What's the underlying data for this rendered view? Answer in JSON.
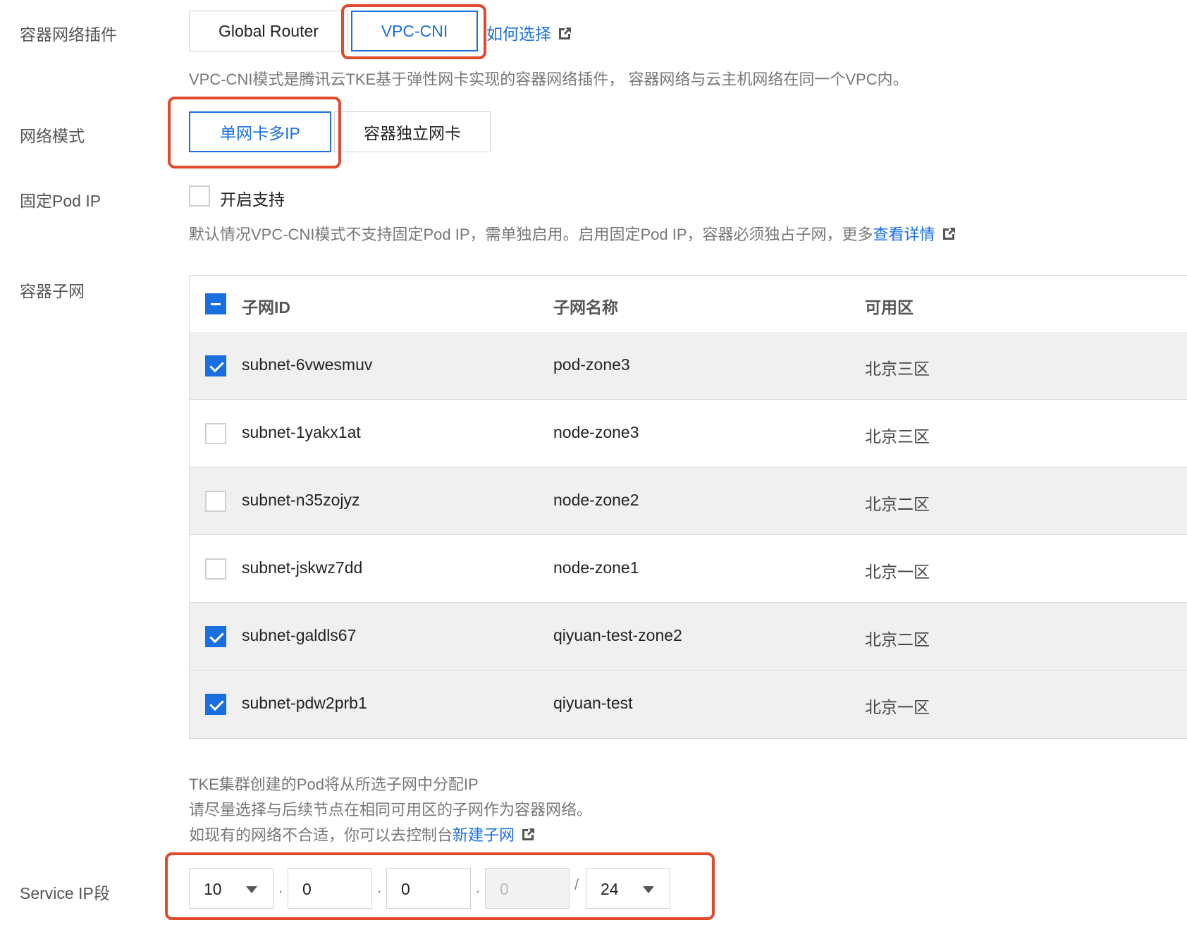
{
  "plugin": {
    "label": "容器网络插件",
    "options": [
      "Global Router",
      "VPC-CNI"
    ],
    "selected": "VPC-CNI",
    "help_link": "如何选择",
    "description": "VPC-CNI模式是腾讯云TKE基于弹性网卡实现的容器网络插件， 容器网络与云主机网络在同一个VPC内。"
  },
  "network_mode": {
    "label": "网络模式",
    "options": [
      "单网卡多IP",
      "容器独立网卡"
    ],
    "selected": "单网卡多IP"
  },
  "fixed_pod_ip": {
    "label": "固定Pod IP",
    "checkbox_label": "开启支持",
    "checked": false,
    "description": "默认情况VPC-CNI模式不支持固定Pod IP，需单独启用。启用固定Pod IP，容器必须独占子网，更多",
    "details_link": "查看详情"
  },
  "subnets": {
    "label": "容器子网",
    "columns": [
      "子网ID",
      "子网名称",
      "可用区"
    ],
    "rows": [
      {
        "id": "subnet-6vwesmuv",
        "name": "pod-zone3",
        "zone": "北京三区",
        "checked": true
      },
      {
        "id": "subnet-1yakx1at",
        "name": "node-zone3",
        "zone": "北京三区",
        "checked": false
      },
      {
        "id": "subnet-n35zojyz",
        "name": "node-zone2",
        "zone": "北京二区",
        "checked": false
      },
      {
        "id": "subnet-jskwz7dd",
        "name": "node-zone1",
        "zone": "北京一区",
        "checked": false
      },
      {
        "id": "subnet-galdls67",
        "name": "qiyuan-test-zone2",
        "zone": "北京二区",
        "checked": true
      },
      {
        "id": "subnet-pdw2prb1",
        "name": "qiyuan-test",
        "zone": "北京一区",
        "checked": true
      }
    ],
    "note_line1": "TKE集群创建的Pod将从所选子网中分配IP",
    "note_line2": "请尽量选择与后续节点在相同可用区的子网作为容器网络。",
    "note_line3": "如现有的网络不合适，你可以去控制台",
    "note_link": "新建子网"
  },
  "service_ip": {
    "label": "Service IP段",
    "octet1": "10",
    "octet2": "0",
    "octet3": "0",
    "octet4": "0",
    "dot": ".",
    "slash": "/",
    "mask": "24"
  },
  "colors": {
    "accent": "#1a6fe0",
    "highlight": "#e0492b"
  },
  "icons": {
    "external_link": "external-link-icon",
    "dropdown": "chevron-down-icon"
  }
}
